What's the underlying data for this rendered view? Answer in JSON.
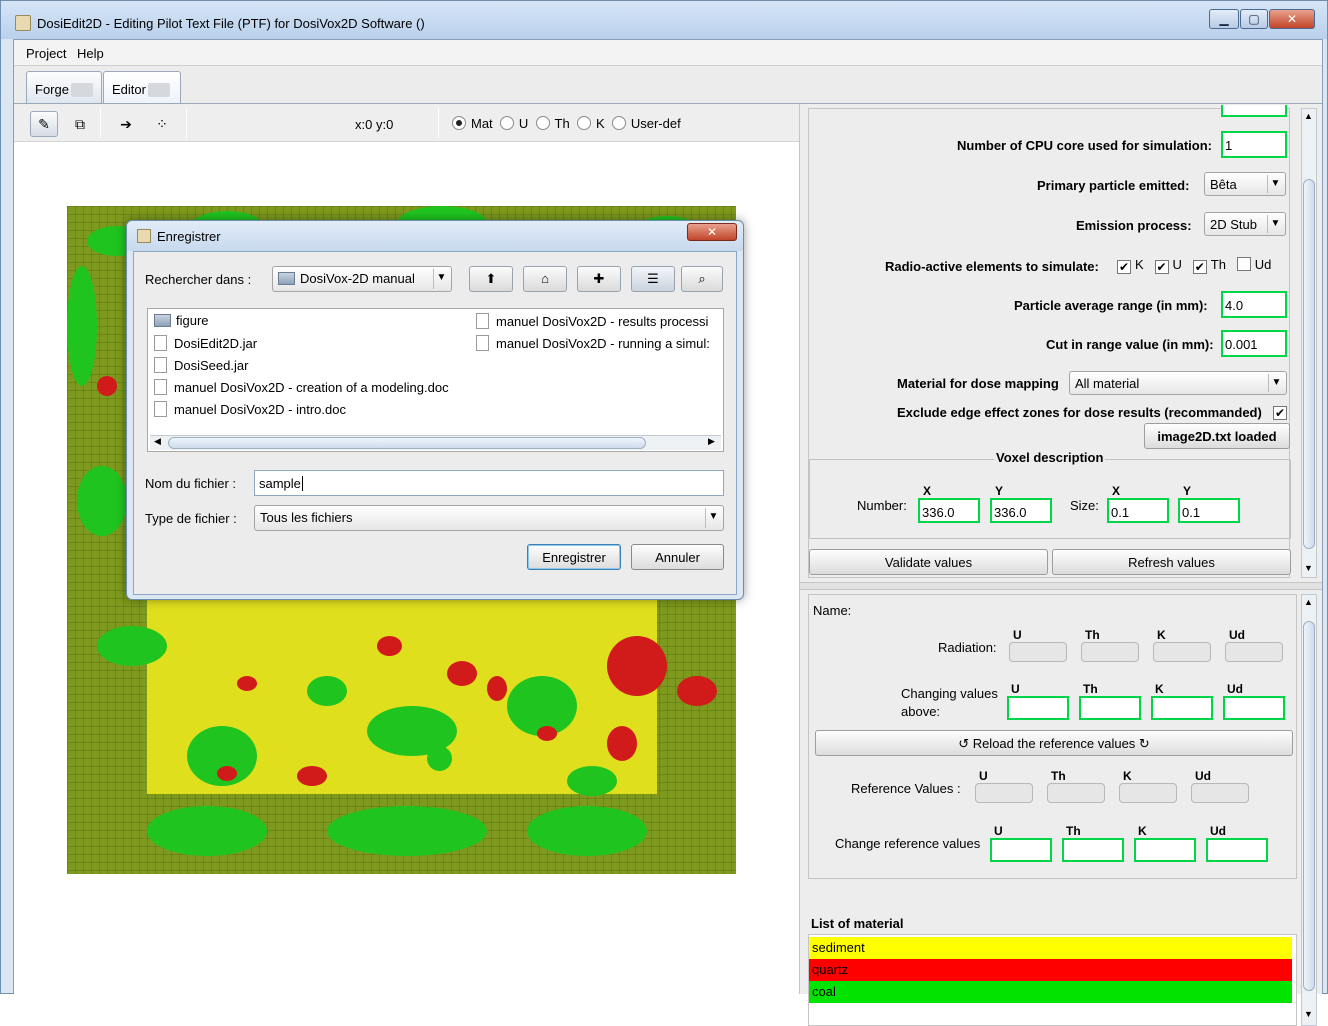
{
  "window": {
    "title": "DosiEdit2D - Editing Pilot Text File (PTF) for DosiVox2D Software ()",
    "min": "▁",
    "max": "▢",
    "close": "✕"
  },
  "menu": [
    "Project",
    "Help"
  ],
  "tabs": [
    {
      "label": "Forge"
    },
    {
      "label": "Editor"
    }
  ],
  "toolbar": {
    "coords": "x:0 y:0",
    "radio_options": [
      "Mat",
      "U",
      "Th",
      "K",
      "User-def"
    ],
    "selected": "Mat"
  },
  "settings": {
    "cpu_label": "Number of CPU core used for simulation:",
    "cpu_value": "1",
    "particle_label": "Primary particle emitted:",
    "particle_value": "Bêta",
    "emission_label": "Emission process:",
    "emission_value": "2D Stub",
    "radio_label": "Radio-active elements to simulate:",
    "elements": [
      {
        "name": "K",
        "checked": true
      },
      {
        "name": "U",
        "checked": true
      },
      {
        "name": "Th",
        "checked": true
      },
      {
        "name": "Ud",
        "checked": false
      }
    ],
    "range_label": "Particle average range (in mm):",
    "range_value": "4.0",
    "cut_label": "Cut in range value (in mm):",
    "cut_value": "0.001",
    "material_label": "Material for dose mapping",
    "material_value": "All material",
    "exclude_label": "Exclude edge effect zones for dose results (recommanded)",
    "exclude_checked": true,
    "image_button": "image2D.txt loaded"
  },
  "voxel": {
    "title": "Voxel description",
    "number_label": "Number:",
    "size_label": "Size:",
    "x_hdr": "X",
    "y_hdr": "Y",
    "number_x": "336.0",
    "number_y": "336.0",
    "size_x": "0.1",
    "size_y": "0.1"
  },
  "actions": {
    "validate": "Validate values",
    "refresh": "Refresh values"
  },
  "material_panel": {
    "name_label": "Name:",
    "radiation_label": "Radiation:",
    "changing_label_1": "Changing values",
    "changing_label_2": "above:",
    "cols": [
      "U",
      "Th",
      "K",
      "Ud"
    ],
    "reload": "↺ Reload the reference values ↻",
    "reference_label": "Reference Values :",
    "change_ref_label": "Change reference values"
  },
  "list": {
    "title": "List of material",
    "items": [
      {
        "name": "sediment",
        "color": "#ffff00"
      },
      {
        "name": "quartz",
        "color": "#ff0000"
      },
      {
        "name": "coal",
        "color": "#00e400"
      }
    ]
  },
  "dialog": {
    "title": "Enregistrer",
    "close": "✕",
    "lookin_label": "Rechercher dans :",
    "lookin_value": "DosiVox-2D manual",
    "files_col1": [
      {
        "name": "figure",
        "dir": true
      },
      {
        "name": "DosiEdit2D.jar",
        "dir": false
      },
      {
        "name": "DosiSeed.jar",
        "dir": false
      },
      {
        "name": "manuel DosiVox2D - creation of a modeling.doc",
        "dir": false
      },
      {
        "name": "manuel DosiVox2D - intro.doc",
        "dir": false
      }
    ],
    "files_col2": [
      {
        "name": "manuel DosiVox2D - results processi",
        "dir": false
      },
      {
        "name": "manuel DosiVox2D - running a simul:",
        "dir": false
      }
    ],
    "filename_label": "Nom du fichier :",
    "filename_value": "sample",
    "filetype_label": "Type de fichier :",
    "filetype_value": "Tous les fichiers",
    "save": "Enregistrer",
    "cancel": "Annuler"
  },
  "colors": {
    "sediment": "#e0df1e",
    "grain_green": "#1fc41f",
    "red": "#d11a1a",
    "border": "#7e9a1e",
    "field_border": "#00d64a"
  }
}
